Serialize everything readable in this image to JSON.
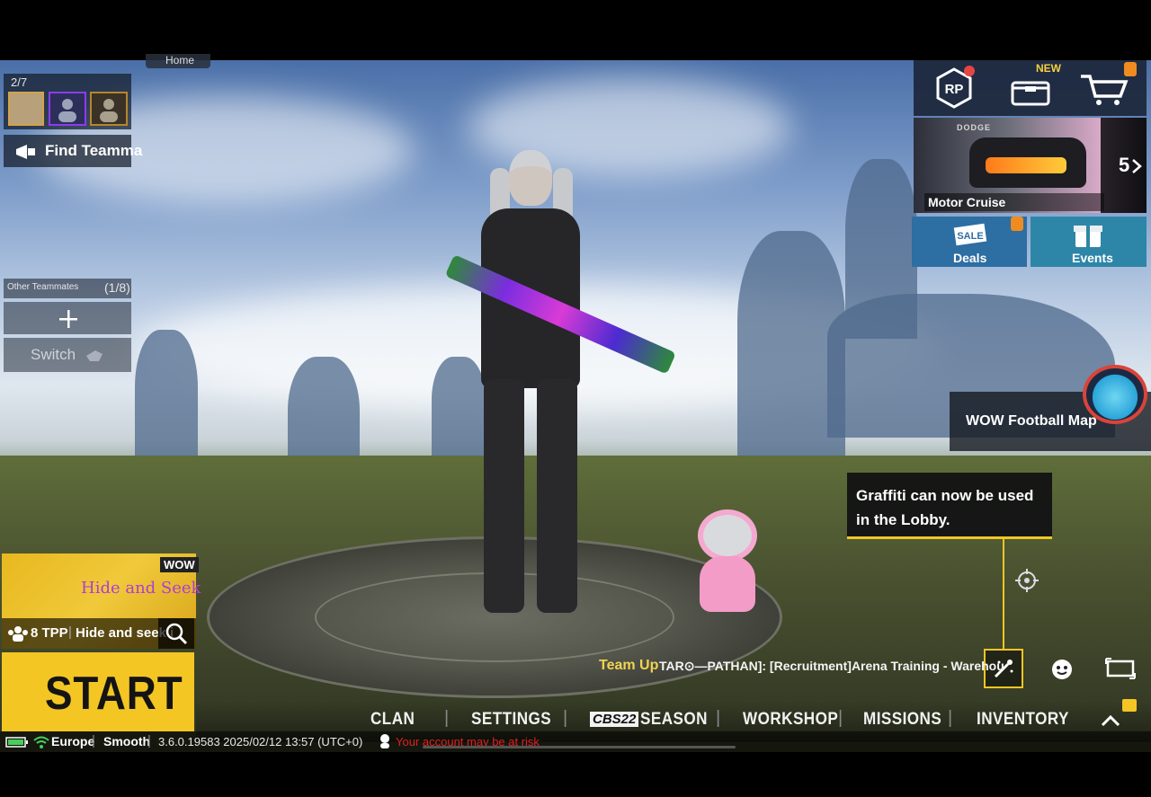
{
  "top_left": {
    "mode_label": "Home",
    "party_count": "2/7",
    "find_teammates": "Find Teamma",
    "other_teammates_label": "Other Teammates",
    "other_teammates_count": "(1/8)",
    "switch_label": "Switch"
  },
  "top_right": {
    "rp_label": "RP",
    "new_badge": "NEW",
    "banner_brand": "DODGE",
    "banner_title": "Motor Cruise",
    "banner_count": "5",
    "deals_label": "Deals",
    "events_label": "Events"
  },
  "side": {
    "map_label": "WOW Football Map",
    "graffiti_tip": "Graffiti can now be used in the Lobby."
  },
  "mode_card": {
    "badge": "WOW",
    "art_text": "Hide and Seek",
    "player_mode": "8 TPP",
    "mode_name": "Hide and seek i",
    "start_button": "START"
  },
  "chat": {
    "team_up": "Team Up",
    "message": "TAR⊙—PATHAN]: [Recruitment]Arena Training - Warehou"
  },
  "bottom_nav": {
    "clan": "CLAN",
    "settings": "SETTINGS",
    "season_badge": "CBS22",
    "season": "SEASON",
    "workshop": "WORKSHOP",
    "missions": "MISSIONS",
    "inventory": "INVENTORY"
  },
  "status_bar": {
    "region": "Europe",
    "graphics": "Smooth",
    "version": "3.6.0.19583 2025/02/12 13:57 (UTC+0)",
    "warning": "Your account may be at risk"
  },
  "colors": {
    "accent_yellow": "#f3c623",
    "panel_dark": "#141c28",
    "warning_red": "#e02020",
    "team_up_yellow": "#f2d34f"
  }
}
